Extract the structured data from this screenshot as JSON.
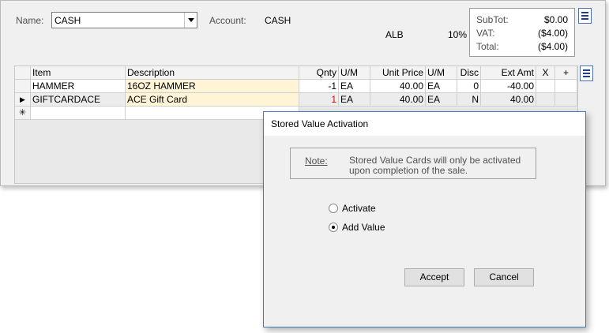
{
  "header": {
    "name_label": "Name:",
    "name_value": "CASH",
    "account_label": "Account:",
    "account_value": "CASH",
    "store_code": "ALB",
    "tax_rate": "10%"
  },
  "totals": {
    "subtot_label": "SubTot:",
    "subtot_value": "$0.00",
    "vat_label": "VAT:",
    "vat_value": "($4.00)",
    "total_label": "Total:",
    "total_value": "($4.00)"
  },
  "grid": {
    "columns": [
      "Item",
      "Description",
      "Qnty",
      "U/M",
      "Unit Price",
      "U/M",
      "Disc",
      "Ext Amt",
      "X",
      "+"
    ],
    "rows": [
      {
        "item": "HAMMER",
        "description": "16OZ HAMMER",
        "qnty": "-1",
        "um": "EA",
        "unit_price": "40.00",
        "um2": "EA",
        "disc": "0",
        "ext_amt": "-40.00",
        "x": "",
        "plus": ""
      },
      {
        "item": "GIFTCARDACE",
        "description": "ACE Gift Card",
        "qnty": "1",
        "um": "EA",
        "unit_price": "40.00",
        "um2": "EA",
        "disc": "N",
        "ext_amt": "40.00",
        "x": "",
        "plus": ""
      }
    ],
    "current_row_marker": "▶",
    "new_row_marker": "✳"
  },
  "dialog": {
    "title": "Stored Value Activation",
    "note_label": "Note:",
    "note_text": "Stored Value Cards will only be activated upon completion of the sale.",
    "options": [
      {
        "label": "Activate",
        "selected": false
      },
      {
        "label": "Add Value",
        "selected": true
      }
    ],
    "accept_label": "Accept",
    "cancel_label": "Cancel"
  },
  "icons": {
    "menu": "menu-list-icon",
    "dropdown": "chevron-down-icon"
  },
  "colors": {
    "dialog_border": "#3e7bbf",
    "description_cell": "#fff5d6",
    "negative_qty": "#d40000"
  }
}
